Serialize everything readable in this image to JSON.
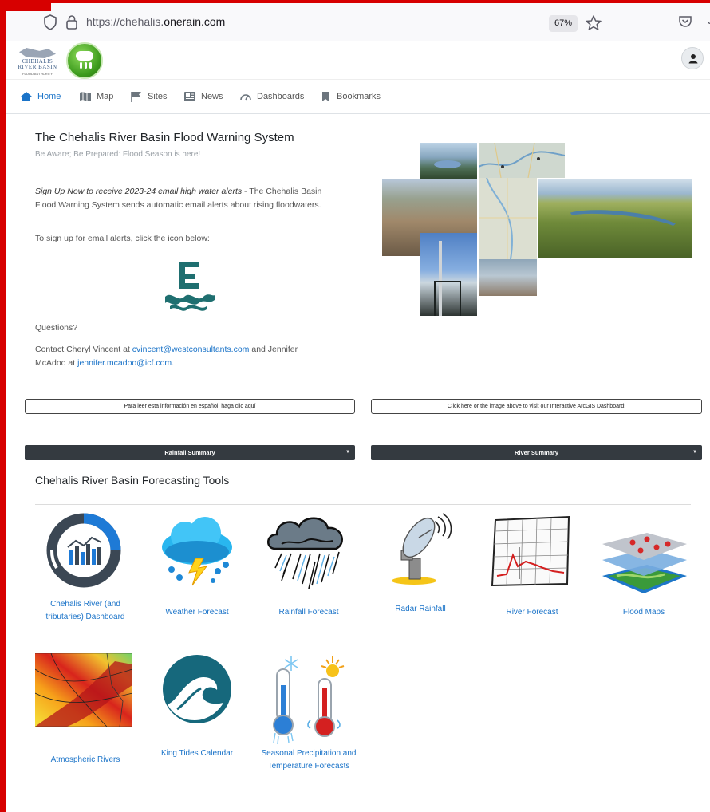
{
  "browser": {
    "url_prefix": "https://chehalis.",
    "url_domain": "onerain.com",
    "zoom": "67%",
    "ext_glyph": "J"
  },
  "header": {
    "logo_text": "CHEHALIS RIVER BASIN",
    "logo_sub": "FLOOD AUTHORITY"
  },
  "nav": {
    "items": [
      {
        "label": "Home",
        "icon": "home-icon"
      },
      {
        "label": "Map",
        "icon": "map-icon"
      },
      {
        "label": "Sites",
        "icon": "flag-icon"
      },
      {
        "label": "News",
        "icon": "news-icon"
      },
      {
        "label": "Dashboards",
        "icon": "gauge-icon"
      },
      {
        "label": "Bookmarks",
        "icon": "bookmark-icon"
      }
    ]
  },
  "main": {
    "title": "The Chehalis River Basin Flood Warning System",
    "subtitle": "Be Aware; Be Prepared: Flood Season is here!",
    "signup_em": "Sign Up Now to receive 2023-24 email high water alerts",
    "signup_rest": " - The Chehalis Basin Flood Warning System sends automatic email alerts about rising floodwaters.",
    "signup_instr": "To sign up for email alerts, click the icon below:",
    "questions": "Questions?",
    "contact_1": "Contact Cheryl Vincent at ",
    "contact_email_1": "cvincent@westconsultants.com",
    "contact_2": " and Jennifer McAdoo at ",
    "contact_email_2": "jennifer.mcadoo@icf.com",
    "contact_3": "."
  },
  "buttons": {
    "spanish": "Para leer esta información en español, haga clic aquí",
    "dashboard": "Click here or the image above to visit our Interactive ArcGIS Dashboard!"
  },
  "dropdowns": {
    "rainfall": "Rainfall Summary",
    "river": "River Summary"
  },
  "tools": {
    "title": "Chehalis River Basin Forecasting Tools",
    "items": [
      {
        "label": "Chehalis River (and tributaries) Dashboard",
        "icon": "dashboard-gauge-icon"
      },
      {
        "label": "Weather Forecast",
        "icon": "storm-cloud-icon"
      },
      {
        "label": "Rainfall Forecast",
        "icon": "rain-cloud-icon"
      },
      {
        "label": "Radar Rainfall",
        "icon": "radar-dish-icon"
      },
      {
        "label": "River Forecast",
        "icon": "hydrograph-icon"
      },
      {
        "label": "Flood Maps",
        "icon": "layered-map-icon"
      },
      {
        "label": "Atmospheric Rivers",
        "icon": "atmospheric-river-map-icon"
      },
      {
        "label": "King Tides Calendar",
        "icon": "wave-icon"
      },
      {
        "label": "Seasonal Precipitation and Temperature Forecasts",
        "icon": "thermometers-icon"
      }
    ]
  },
  "colors": {
    "link": "#1a73c8",
    "dark_bar": "#343a40",
    "frame": "#d70000"
  }
}
